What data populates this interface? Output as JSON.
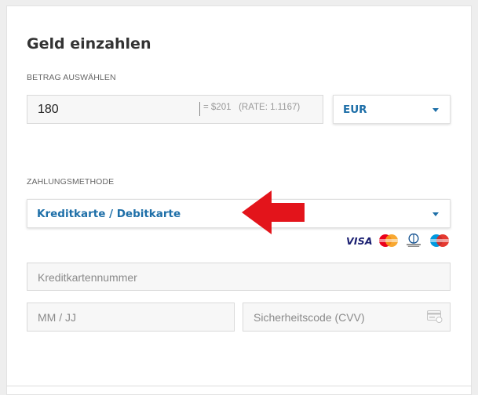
{
  "title": "Geld einzahlen",
  "amount": {
    "label": "BETRAG AUSWÄHLEN",
    "value": "180",
    "conversion": "= $201   (RATE: 1.1167)"
  },
  "currency": {
    "selected": "EUR"
  },
  "payment": {
    "label": "ZAHLUNGSMETHODE",
    "selected": "Kreditkarte / Debitkarte",
    "card_brands": [
      "visa",
      "mastercard",
      "diners-club",
      "maestro"
    ],
    "visa_text": "VISA"
  },
  "card_form": {
    "card_number_placeholder": "Kreditkartennummer",
    "expiry_placeholder": "MM / JJ",
    "cvv_placeholder": "Sicherheitscode (CVV)"
  },
  "colors": {
    "accent": "#1e6fa8",
    "arrow": "#e3141b"
  },
  "icons": [
    "dropdown-caret-icon",
    "red-arrow-icon",
    "cvv-card-icon"
  ]
}
